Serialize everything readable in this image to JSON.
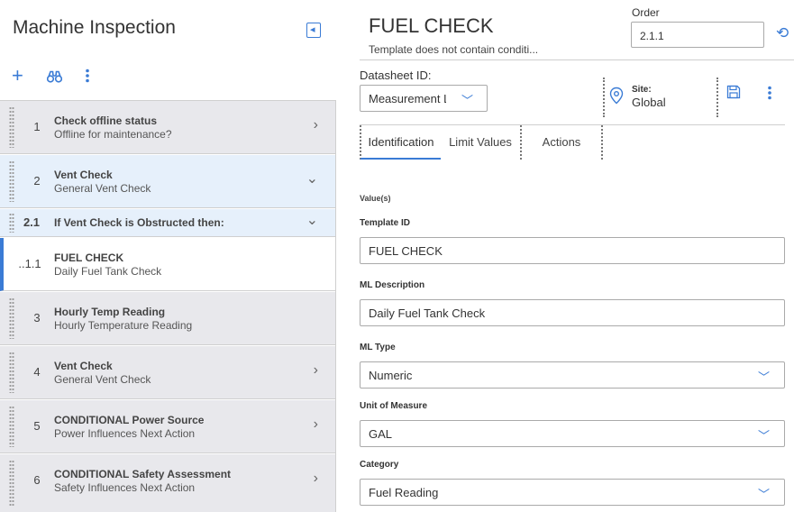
{
  "app": {
    "title": "Machine Inspection"
  },
  "toolbar": {
    "add_icon": "plus-icon",
    "find_icon": "binoculars-icon",
    "more_icon": "vertical-dots-icon"
  },
  "steps": [
    {
      "num": "1",
      "title": "Check offline status",
      "sub": "Offline for maintenance?",
      "arrow": "›",
      "style": "gray"
    },
    {
      "num": "2",
      "title": "Vent Check",
      "sub": "General Vent Check",
      "arrow": "⌄",
      "style": "blue"
    },
    {
      "num": "2.1",
      "title": "If Vent Check is Obstructed then:",
      "sub": "",
      "arrow": "⌄",
      "style": "blue"
    },
    {
      "num": "..1.1",
      "title": "FUEL CHECK",
      "sub": "Daily Fuel Tank Check",
      "arrow": "",
      "style": "white"
    },
    {
      "num": "3",
      "title": "Hourly Temp Reading",
      "sub": "Hourly Temperature Reading",
      "arrow": "",
      "style": "gray"
    },
    {
      "num": "4",
      "title": "Vent Check",
      "sub": "General Vent Check",
      "arrow": "›",
      "style": "gray"
    },
    {
      "num": "5",
      "title": "CONDITIONAL Power Source",
      "sub": "Power Influences Next Action",
      "arrow": "›",
      "style": "gray"
    },
    {
      "num": "6",
      "title": "CONDITIONAL Safety Assessment",
      "sub": "Safety Influences Next Action",
      "arrow": "›",
      "style": "gray"
    }
  ],
  "detail": {
    "title": "FUEL CHECK",
    "subtitle": "Template does not contain conditi...",
    "order_label": "Order",
    "order_value": "2.1.1",
    "datasheet_label": "Datasheet ID:",
    "datasheet_value": "Measurement Loc",
    "site_label": "Site:",
    "site_value": "Global",
    "tabs": [
      "Identification",
      "Limit Values",
      "Actions"
    ],
    "values_label": "Value(s)",
    "fields": [
      {
        "label": "Template ID",
        "value": "FUEL CHECK",
        "dropdown": false
      },
      {
        "label": "ML Description",
        "value": "Daily Fuel Tank Check",
        "dropdown": false
      },
      {
        "label": "ML Type",
        "value": "Numeric",
        "dropdown": true
      },
      {
        "label": "Unit of Measure",
        "value": "GAL",
        "dropdown": true
      },
      {
        "label": "Category",
        "value": "Fuel Reading",
        "dropdown": true
      }
    ]
  },
  "colors": {
    "accent": "#3a7bd5",
    "row_gray": "#e8e8ec",
    "row_blue": "#e6f0fb"
  }
}
